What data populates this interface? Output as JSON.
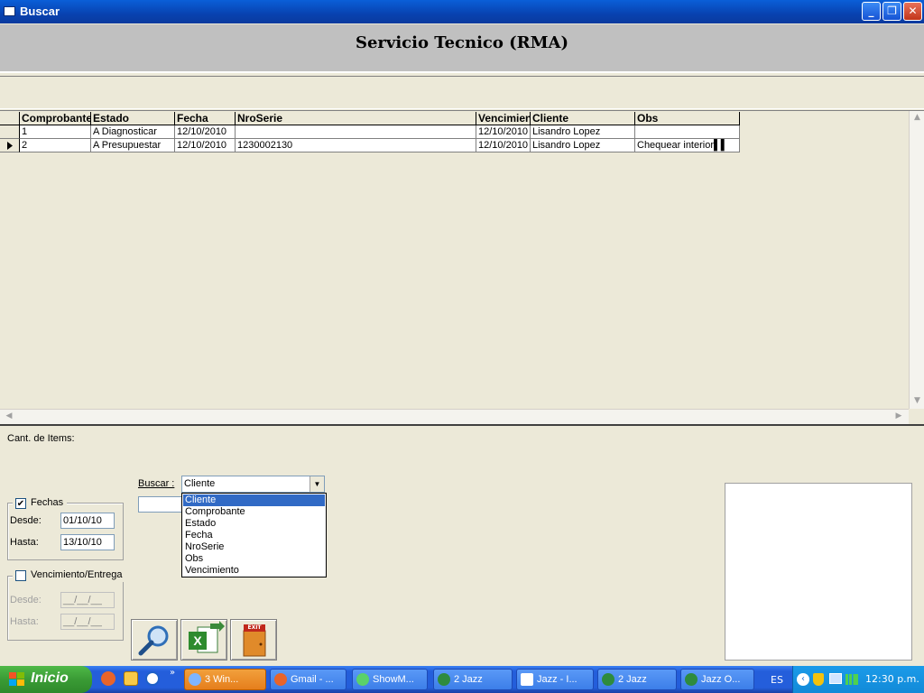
{
  "window": {
    "title": "Buscar",
    "controls": [
      "_",
      "❐",
      "✕"
    ]
  },
  "header": {
    "title": "Servicio Tecnico (RMA)"
  },
  "grid": {
    "columns": [
      "Comprobante",
      "Estado",
      "Fecha",
      "NroSerie",
      "Vencimiento",
      "Cliente",
      "Obs"
    ],
    "rows": [
      {
        "selected": false,
        "cells": [
          "1",
          "A Diagnosticar",
          "12/10/2010",
          "",
          "12/10/2010",
          "Lisandro Lopez",
          ""
        ]
      },
      {
        "selected": true,
        "cells": [
          "2",
          "A Presupuestar",
          "12/10/2010",
          "1230002130",
          "12/10/2010",
          "Lisandro Lopez",
          "Chequear interior▌▌"
        ]
      }
    ]
  },
  "bottom": {
    "count_label": "Cant. de Items:",
    "buscar_label": "Buscar :",
    "buscar_value": "Cliente",
    "buscar_options": [
      "Cliente",
      "Comprobante",
      "Estado",
      "Fecha",
      "NroSerie",
      "Obs",
      "Vencimiento"
    ],
    "fechas": {
      "label": "Fechas",
      "checked": true,
      "desde_label": "Desde:",
      "desde": "01/10/10",
      "hasta_label": "Hasta:",
      "hasta": "13/10/10"
    },
    "vencimiento": {
      "label": "Vencimiento/Entrega",
      "checked": false,
      "desde_label": "Desde:",
      "desde": "__/__/__",
      "hasta_label": "Hasta:",
      "hasta": "__/__/__"
    },
    "exit_text": "EXIT"
  },
  "taskbar": {
    "start": "Inicio",
    "buttons": [
      "3 Win...",
      "Gmail - ...",
      "ShowM...",
      "2 Jazz",
      "Jazz - I...",
      "2 Jazz",
      "Jazz O..."
    ],
    "lang": "ES",
    "clock": "12:30 p.m."
  }
}
